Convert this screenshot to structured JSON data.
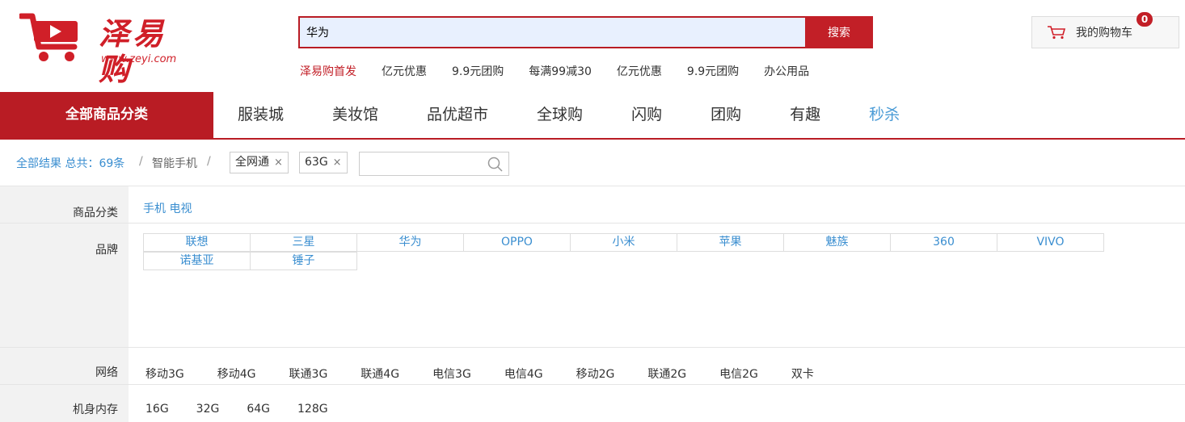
{
  "header": {
    "logo_text": "泽易购",
    "logo_url": "www.zeyi.com",
    "search_value": "华为",
    "search_button": "搜索",
    "hot_links": [
      "泽易购首发",
      "亿元优惠",
      "9.9元团购",
      "每满99减30",
      "亿元优惠",
      "9.9元团购",
      "办公用品"
    ],
    "cart_label": "我的购物车",
    "cart_count": "0"
  },
  "nav": {
    "all_label": "全部商品分类",
    "items": [
      "服装城",
      "美妆馆",
      "品优超市",
      "全球购",
      "闪购",
      "团购",
      "有趣",
      "秒杀"
    ]
  },
  "crumbs": {
    "all": "全部结果 总共：69条",
    "sep1": "/",
    "category": "智能手机",
    "sep2": "/",
    "tags": [
      "全网通",
      "63G"
    ],
    "close_glyph": "×"
  },
  "filters": {
    "category_label": "商品分类",
    "category_values": "手机 电视",
    "brand_label": "品牌",
    "brands": [
      "联想",
      "三星",
      "华为",
      "OPPO",
      "小米",
      "苹果",
      "魅族",
      "360",
      "VIVO",
      "诺基亚",
      "锤子"
    ],
    "network_label": "网络",
    "networks": [
      "移动3G",
      "移动4G",
      "联通3G",
      "联通4G",
      "电信3G",
      "电信4G",
      "移动2G",
      "联通2G",
      "电信2G",
      "双卡"
    ],
    "memory_label": "机身内存",
    "memories": [
      "16G",
      "32G",
      "64G",
      "128G"
    ]
  },
  "colors": {
    "brand_red": "#c21f27",
    "link_blue": "#3a8ed0",
    "active_nav": "#4a9bd6"
  }
}
